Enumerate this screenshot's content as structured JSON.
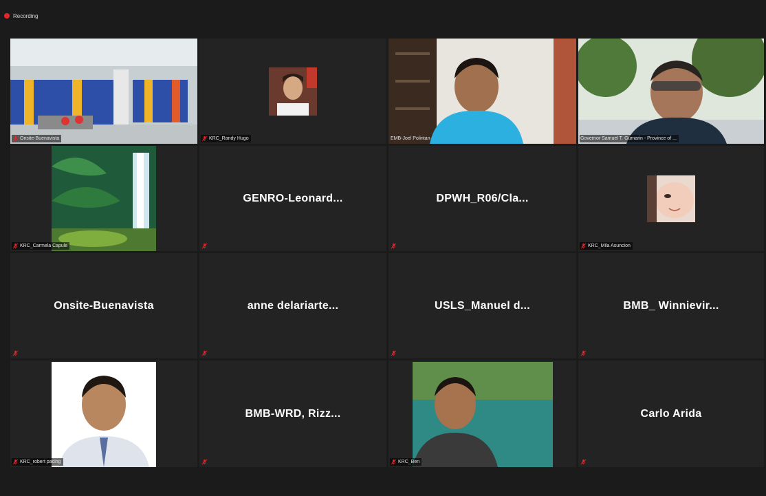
{
  "recording": {
    "label": "Recording"
  },
  "icons": {
    "mic": "mic-muted-icon",
    "record": "record-dot-icon"
  },
  "colors": {
    "tile_bg": "#232323",
    "active_speaker": "#c9d96a",
    "muted": "#e0262b"
  },
  "participants": [
    {
      "id": "onsite-video",
      "label": "Onsite-Buenavista",
      "has_video": true,
      "muted": true
    },
    {
      "id": "randy",
      "label": "KRC_Randy Hugo",
      "has_video": true,
      "muted": true
    },
    {
      "id": "joel",
      "label": "EMB-Joel Polintan",
      "has_video": true,
      "muted": false,
      "active": true
    },
    {
      "id": "governor",
      "label": "Governor Samuel T. Gumarin - Province of ...",
      "has_video": true,
      "muted": false
    },
    {
      "id": "carmela",
      "label": "KRC_Carmela Capule",
      "has_video": true,
      "muted": true
    },
    {
      "id": "genro",
      "display_name": "GENRO-Leonard...",
      "has_video": false,
      "muted": true
    },
    {
      "id": "dpwh",
      "display_name": "DPWH_R06/Cla...",
      "has_video": false,
      "muted": true
    },
    {
      "id": "mila",
      "label": "KRC_Mila Asuncion",
      "has_video": true,
      "muted": true
    },
    {
      "id": "onsite2",
      "display_name": "Onsite-Buenavista",
      "has_video": false,
      "muted": true
    },
    {
      "id": "anne",
      "display_name": "anne delariarte...",
      "has_video": false,
      "muted": true
    },
    {
      "id": "usls",
      "display_name": "USLS_Manuel d...",
      "has_video": false,
      "muted": true
    },
    {
      "id": "bmb",
      "display_name": "BMB_ Winnievir...",
      "has_video": false,
      "muted": true
    },
    {
      "id": "robert",
      "label": "KRC_robert pacing",
      "has_video": true,
      "muted": true
    },
    {
      "id": "rizz",
      "display_name": "BMB-WRD, Rizz...",
      "has_video": false,
      "muted": true
    },
    {
      "id": "ben",
      "label": "KRC_Ben",
      "has_video": true,
      "muted": true
    },
    {
      "id": "carlo",
      "display_name": "Carlo Arida",
      "has_video": false,
      "muted": true
    }
  ]
}
